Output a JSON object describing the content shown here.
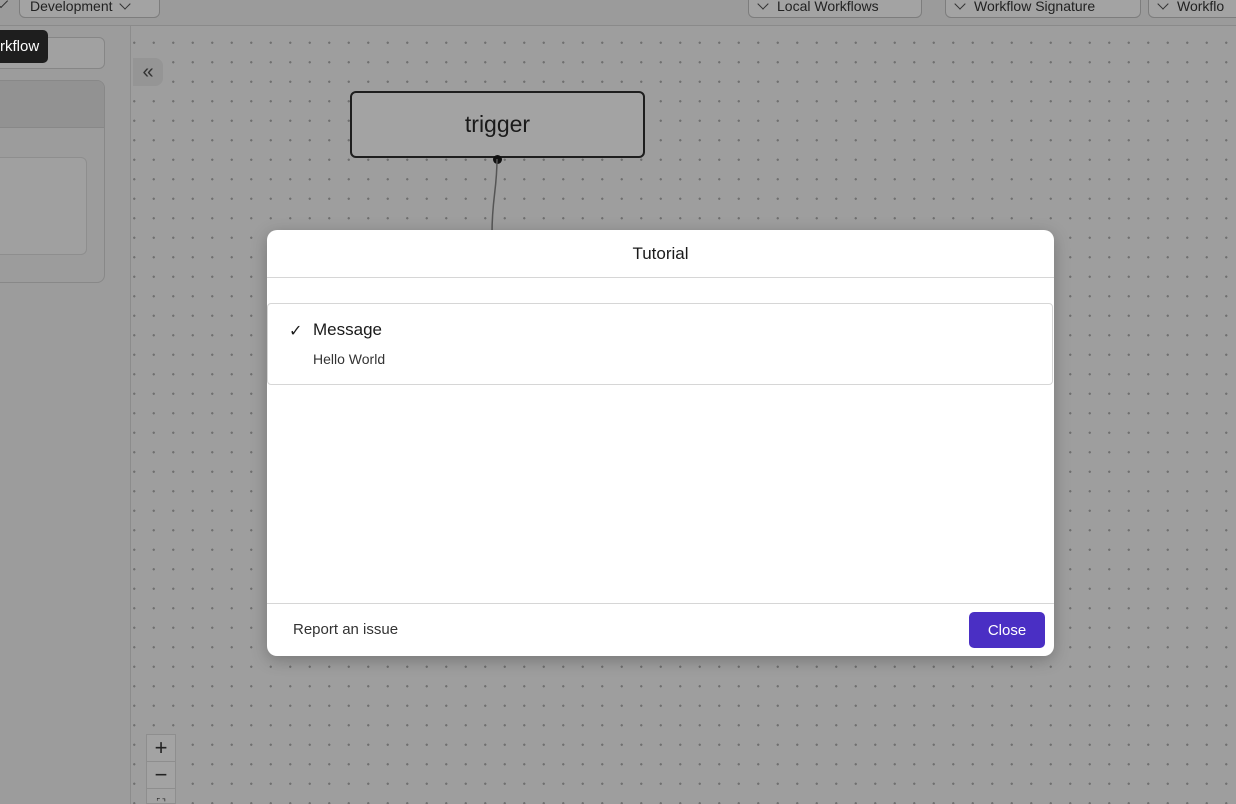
{
  "topbar": {
    "environment_label": "Development",
    "buttons": [
      {
        "label": "Local Workflows"
      },
      {
        "label": "Workflow Signature"
      },
      {
        "label": "Workflo"
      }
    ]
  },
  "sidebar": {
    "tooltip": "rkflow"
  },
  "canvas": {
    "collapse_icon": "«",
    "trigger_node": "trigger",
    "zoom": {
      "in": "+",
      "out": "−",
      "fit": "⛶"
    }
  },
  "modal": {
    "title": "Tutorial",
    "steps": [
      {
        "title": "Message",
        "description": "Hello World",
        "check_icon": "✓"
      }
    ],
    "report_label": "Report an issue",
    "close_label": "Close"
  },
  "colors": {
    "accent": "#4a2fc4"
  }
}
